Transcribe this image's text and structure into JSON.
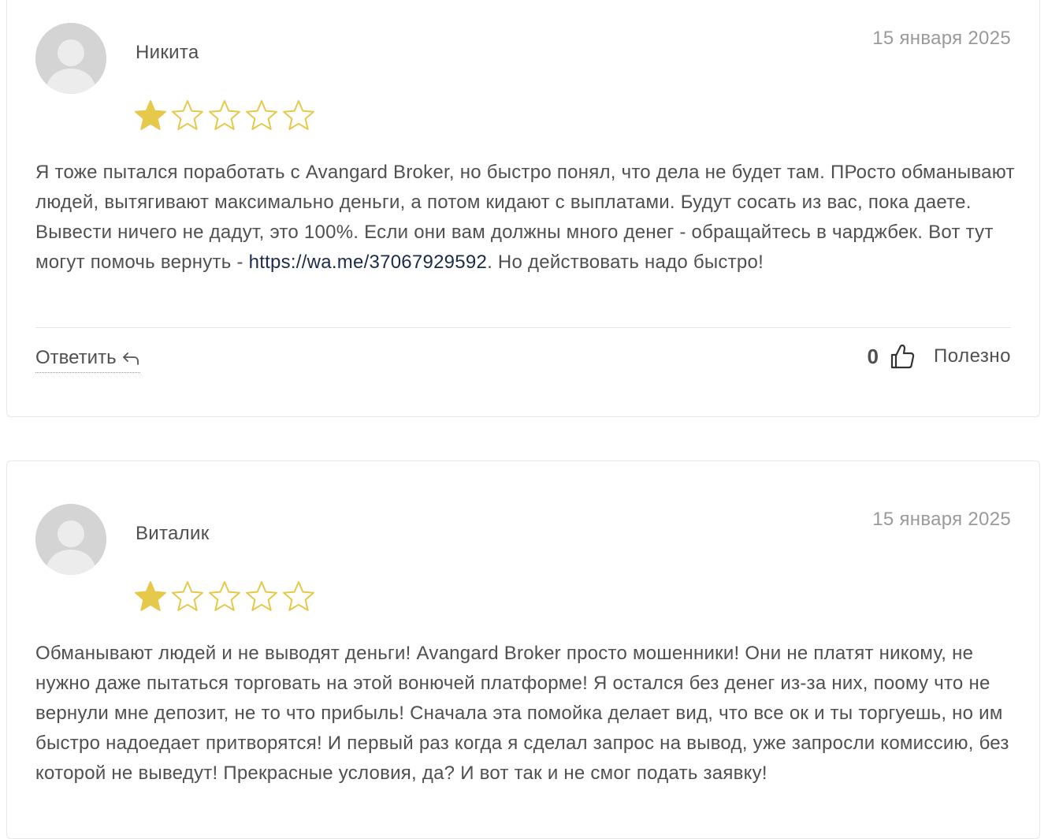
{
  "reviews": [
    {
      "author": "Никита",
      "date": "15 января 2025",
      "rating": 1,
      "rating_max": 5,
      "text_before_link": "Я тоже пытался поработать с Avangard Broker, но быстро понял, что дела не будет там. ПРосто обманывают людей, вытягивают максимально деньги, а потом кидают с выплатами. Будут сосать из вас, пока даете. Вывести ничего не дадут, это 100%. Если они вам должны много денег - обращайтесь в чарджбек. Вот тут могут помочь вернуть - ",
      "link_text": "https://wa.me/37067929592",
      "text_after_link": ". Но действовать надо быстро!",
      "reply_label": "Ответить",
      "useful_count": "0",
      "useful_label": "Полезно"
    },
    {
      "author": "Виталик",
      "date": "15 января 2025",
      "rating": 1,
      "rating_max": 5,
      "text": "Обманывают людей и не выводят деньги! Avangard Broker просто мошенники! Они не платят никому, не нужно даже пытаться торговать на этой вонючей платформе! Я остался без денег из-за них, поому что не вернули мне депозит, не то что прибыль! Сначала эта помойка делает вид, что все ок и ты торгуешь, но им быстро надоедает притворятся! И первый раз когда я сделал запрос на вывод, уже запросли комиссию, без которой не выведут! Прекрасные условия, да? И вот так и не смог подать заявку!"
    }
  ],
  "colors": {
    "star_fill": "#e6c84a",
    "star_outline": "#e6c84a",
    "link": "#1c2b4a",
    "date": "#9a9a9a"
  },
  "icons": {
    "avatar": "user-avatar-icon",
    "star": "star-icon",
    "reply": "reply-arrow-icon",
    "thumb": "thumbs-up-icon"
  }
}
